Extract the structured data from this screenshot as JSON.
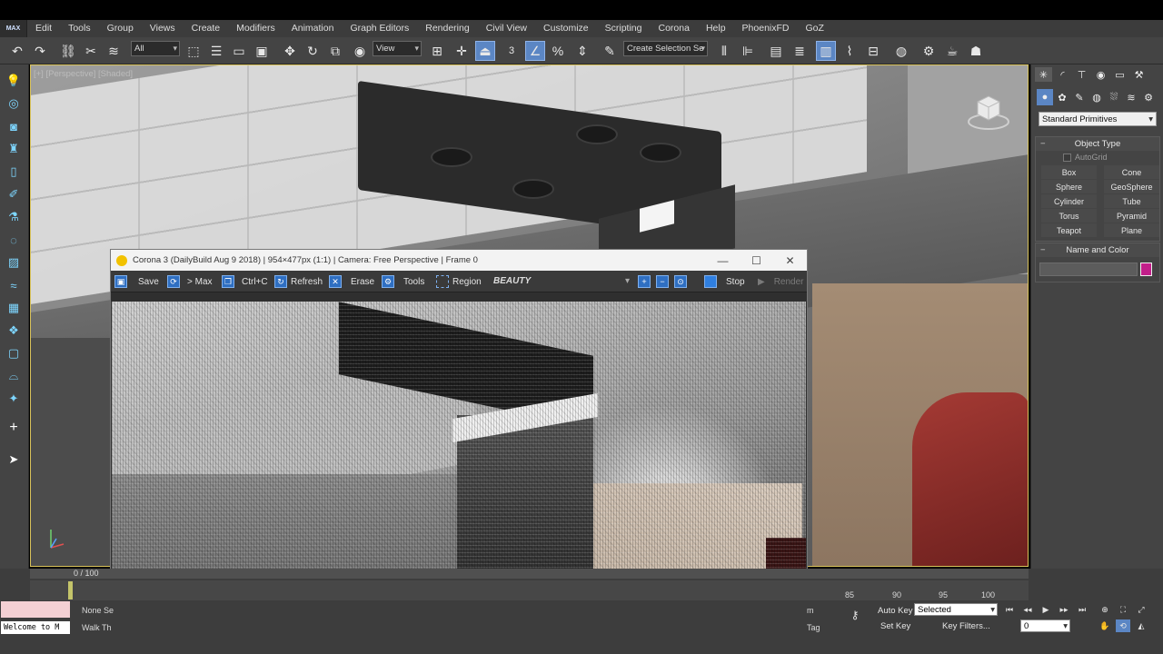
{
  "app": {
    "logo_text": "MAX"
  },
  "menu": [
    "Edit",
    "Tools",
    "Group",
    "Views",
    "Create",
    "Modifiers",
    "Animation",
    "Graph Editors",
    "Rendering",
    "Civil View",
    "Customize",
    "Scripting",
    "Corona",
    "Help",
    "PhoenixFD",
    "GoZ"
  ],
  "toolbar": {
    "selection_filter": "All",
    "reference_coord": "View",
    "named_selection": "Create Selection Se",
    "snap_number": "3"
  },
  "viewport": {
    "label": "[+] [Perspective] [Shaded]"
  },
  "vfb": {
    "title": "Corona 3 (DailyBuild Aug  9 2018) | 954×477px (1:1) | Camera: Free Perspective | Frame 0",
    "buttons": {
      "save": "Save",
      "to_max": "> Max",
      "copy": "Ctrl+C",
      "refresh": "Refresh",
      "erase": "Erase",
      "tools": "Tools",
      "region": "Region",
      "stop": "Stop",
      "render": "Render"
    },
    "render_pass": "BEAUTY"
  },
  "command_panel": {
    "category": "Standard Primitives",
    "object_type_title": "Object Type",
    "autogrid": "AutoGrid",
    "objects": [
      "Box",
      "Cone",
      "Sphere",
      "GeoSphere",
      "Cylinder",
      "Tube",
      "Torus",
      "Pyramid",
      "Teapot",
      "Plane"
    ],
    "name_color_title": "Name and Color",
    "color": "#c21f8a"
  },
  "timeline": {
    "frame": "0 / 100",
    "ticks": [
      "85",
      "90",
      "95",
      "100"
    ]
  },
  "status": {
    "maxscript": "Welcome to M",
    "selection": "None Se",
    "walk": "Walk Th",
    "auto_key": "Auto Key",
    "set_key": "Set Key",
    "key_mode": "Selected",
    "key_filters": "Key Filters...",
    "current_frame": "0",
    "tag_text": "Tag",
    "m_text": "m"
  }
}
